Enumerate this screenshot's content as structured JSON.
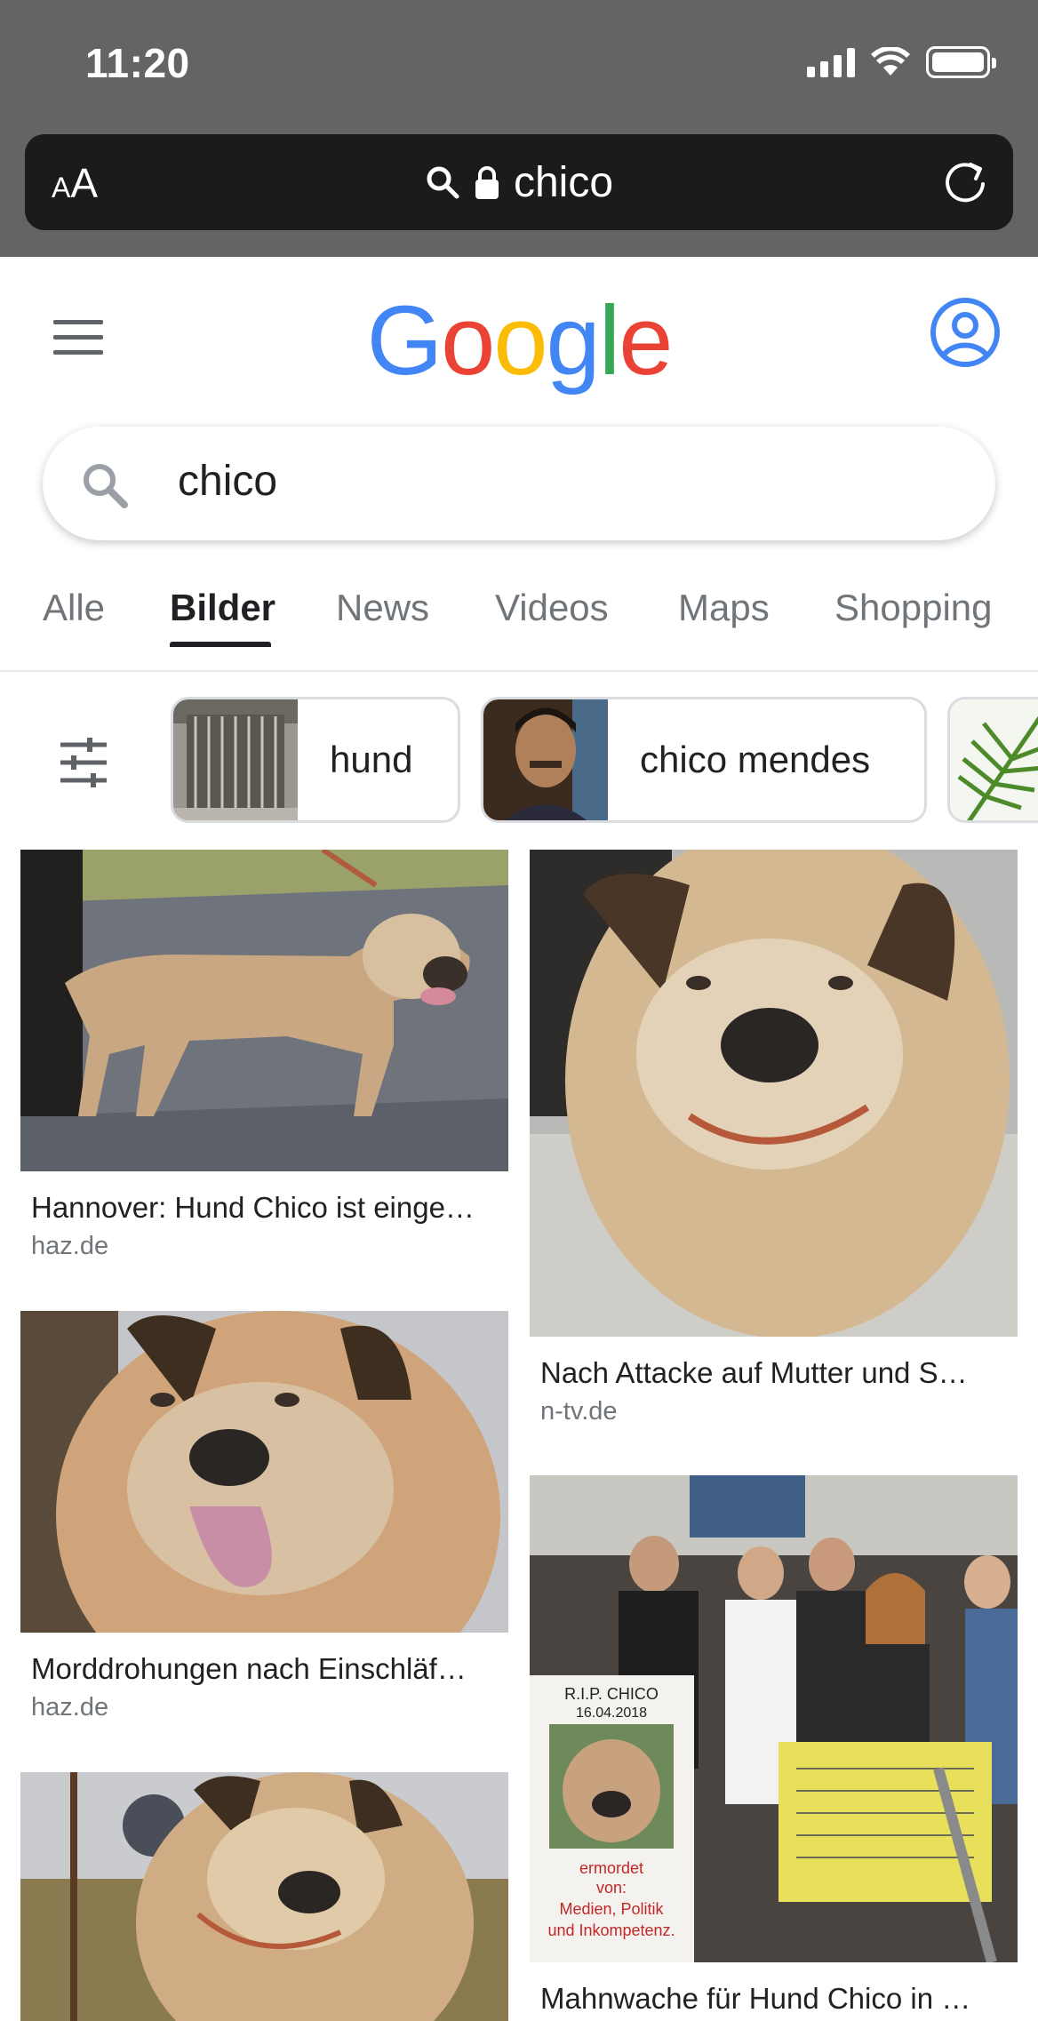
{
  "status": {
    "time": "11:20"
  },
  "browser": {
    "text_size_label_small": "A",
    "text_size_label_large": "A",
    "url": "chico"
  },
  "header": {
    "logo_letters": [
      "G",
      "o",
      "o",
      "g",
      "l",
      "e"
    ],
    "logo_colors": [
      "#4285F4",
      "#EA4335",
      "#FBBC05",
      "#4285F4",
      "#34A853",
      "#EA4335"
    ]
  },
  "search": {
    "query": "chico"
  },
  "tabs": [
    {
      "label": "Alle",
      "active": false
    },
    {
      "label": "Bilder",
      "active": true
    },
    {
      "label": "News",
      "active": false
    },
    {
      "label": "Videos",
      "active": false
    },
    {
      "label": "Maps",
      "active": false
    },
    {
      "label": "Shopping",
      "active": false
    }
  ],
  "chips": [
    {
      "label": "hund"
    },
    {
      "label": "chico mendes"
    },
    {
      "label": ""
    }
  ],
  "results": [
    {
      "title": "Hannover: Hund Chico ist einge…",
      "source": "haz.de"
    },
    {
      "title": "Nach Attacke auf Mutter und S…",
      "source": "n-tv.de"
    },
    {
      "title": "Morddrohungen nach Einschläf…",
      "source": "haz.de"
    },
    {
      "title": "Mahnwache für Hund Chico in …",
      "source": ""
    },
    {
      "title": "",
      "source": ""
    }
  ],
  "poster_text": {
    "rip": "R.I.P. CHICO",
    "date": "16.04.2018",
    "line1": "ermordet",
    "line2": "von:",
    "line3": "Medien, Politik",
    "line4": "und Inkompetenz."
  },
  "colors": {
    "accent_blue": "#4285F4",
    "status_bar": "#646464",
    "url_bar": "#1b1b1b"
  }
}
